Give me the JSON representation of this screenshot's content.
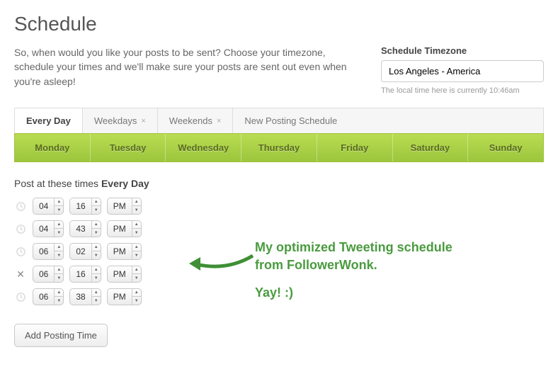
{
  "title": "Schedule",
  "intro": "So, when would you like your posts to be sent? Choose your timezone, schedule your times and we'll make sure your posts are sent out even when you're asleep!",
  "timezone": {
    "label": "Schedule Timezone",
    "value": "Los Angeles - America",
    "hint": "The local time here is currently 10:46am"
  },
  "tabs": {
    "every_day": "Every Day",
    "weekdays": "Weekdays",
    "weekends": "Weekends",
    "new_schedule": "New Posting Schedule",
    "close_x": "×"
  },
  "days": {
    "mon": "Monday",
    "tue": "Tuesday",
    "wed": "Wednesday",
    "thu": "Thursday",
    "fri": "Friday",
    "sat": "Saturday",
    "sun": "Sunday"
  },
  "post_label_prefix": "Post at these times ",
  "post_label_bold": "Every Day",
  "times": [
    {
      "hour": "04",
      "min": "16",
      "ampm": "PM"
    },
    {
      "hour": "04",
      "min": "43",
      "ampm": "PM"
    },
    {
      "hour": "06",
      "min": "02",
      "ampm": "PM"
    },
    {
      "hour": "06",
      "min": "16",
      "ampm": "PM"
    },
    {
      "hour": "06",
      "min": "38",
      "ampm": "PM"
    }
  ],
  "annotation": {
    "line1": "My optimized Tweeting schedule",
    "line2": "from FollowerWonk.",
    "line3": "Yay! :)"
  },
  "add_button": "Add Posting Time"
}
